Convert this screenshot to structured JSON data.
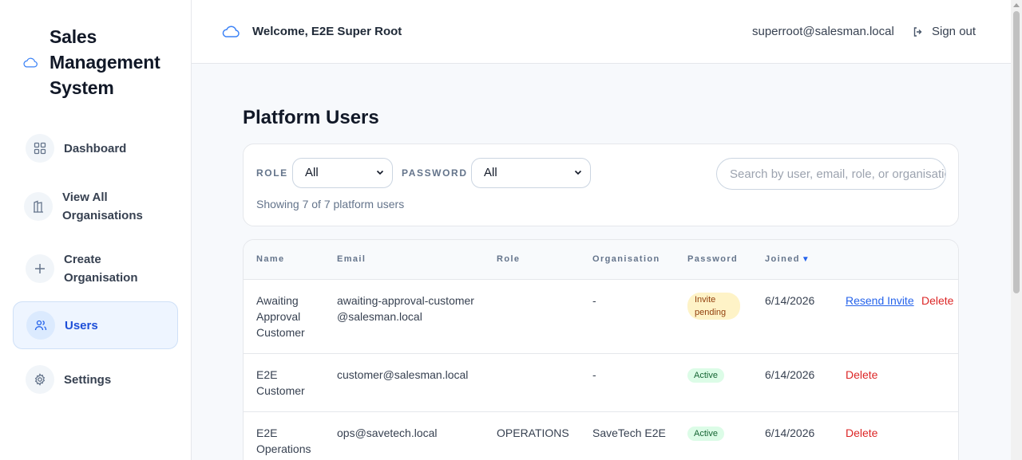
{
  "brand": {
    "title": "Sales Management System",
    "icon": "cloud-icon"
  },
  "sidebar": {
    "items": [
      {
        "label": "Dashboard",
        "icon": "grid-icon",
        "active": false
      },
      {
        "label": "View All Organisations",
        "icon": "building-icon",
        "active": false
      },
      {
        "label": "Create Organisation",
        "icon": "plus-icon",
        "active": false
      },
      {
        "label": "Users",
        "icon": "users-icon",
        "active": true
      },
      {
        "label": "Settings",
        "icon": "gear-icon",
        "active": false
      }
    ]
  },
  "header": {
    "welcome": "Welcome, E2E Super Root",
    "email": "superroot@salesman.local",
    "signout": "Sign out"
  },
  "main": {
    "title": "Platform Users",
    "filters": {
      "role_label": "ROLE",
      "role_value": "All",
      "password_label": "PASSWORD",
      "password_value": "All",
      "search_placeholder": "Search by user, email, role, or organisation",
      "showing": "Showing 7 of 7 platform users"
    },
    "table": {
      "headers": [
        "Name",
        "Email",
        "Role",
        "Organisation",
        "Password",
        "Joined"
      ],
      "sort_indicator": "▼",
      "rows": [
        {
          "name": "Awaiting Approval Customer",
          "email": "awaiting-approval-customer@salesman.local",
          "role": "",
          "organisation": "-",
          "password": "Invite pending",
          "joined": "6/14/2026",
          "actions": [
            "Resend Invite",
            "Delete"
          ]
        },
        {
          "name": "E2E Customer",
          "email": "customer@salesman.local",
          "role": "",
          "organisation": "-",
          "password": "Active",
          "joined": "6/14/2026",
          "actions": [
            "Delete"
          ]
        },
        {
          "name": "E2E Operations",
          "email": "ops@savetech.local",
          "role": "OPERATIONS",
          "organisation": "SaveTech E2E",
          "password": "Active",
          "joined": "6/14/2026",
          "actions": [
            "Delete"
          ]
        }
      ]
    }
  },
  "colors": {
    "accent": "#2563eb",
    "danger": "#dc2626",
    "pending_bg": "#fef3c7",
    "active_bg": "#dcfce7"
  }
}
